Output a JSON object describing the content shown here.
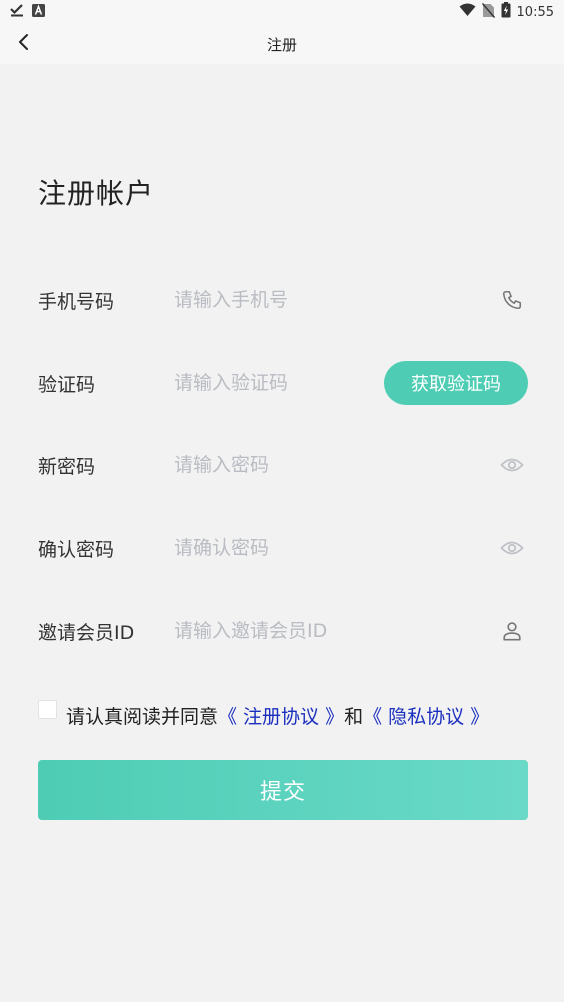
{
  "status_bar": {
    "time": "10:55",
    "left_icons": [
      "download-done-icon",
      "a-letter-icon"
    ],
    "right_icons": [
      "wifi-icon",
      "no-sim-icon",
      "battery-charging-icon"
    ]
  },
  "nav": {
    "title": "注册",
    "back_icon": "chevron-left-icon"
  },
  "page_title": "注册帐户",
  "form": {
    "phone": {
      "label": "手机号码",
      "placeholder": "请输入手机号",
      "value": "",
      "icon": "phone-icon"
    },
    "code": {
      "label": "验证码",
      "placeholder": "请输入验证码",
      "value": "",
      "button": "获取验证码"
    },
    "password": {
      "label": "新密码",
      "placeholder": "请输入密码",
      "value": "",
      "icon": "eye-icon"
    },
    "confirm": {
      "label": "确认密码",
      "placeholder": "请确认密码",
      "value": "",
      "icon": "eye-icon"
    },
    "invite": {
      "label": "邀请会员ID",
      "placeholder": "请输入邀请会员ID",
      "value": "",
      "icon": "user-icon"
    }
  },
  "agreement": {
    "checked": false,
    "prefix": "请认真阅读并同意",
    "link1": "《 注册协议 》",
    "conj": "和",
    "link2": "《 隐私协议 》"
  },
  "submit_label": "提交",
  "colors": {
    "accent": "#4ecdb4",
    "accent_light": "#6ad9c8",
    "link": "#1a2fbe",
    "background": "#f2f2f2",
    "placeholder": "#b9bcc2"
  }
}
